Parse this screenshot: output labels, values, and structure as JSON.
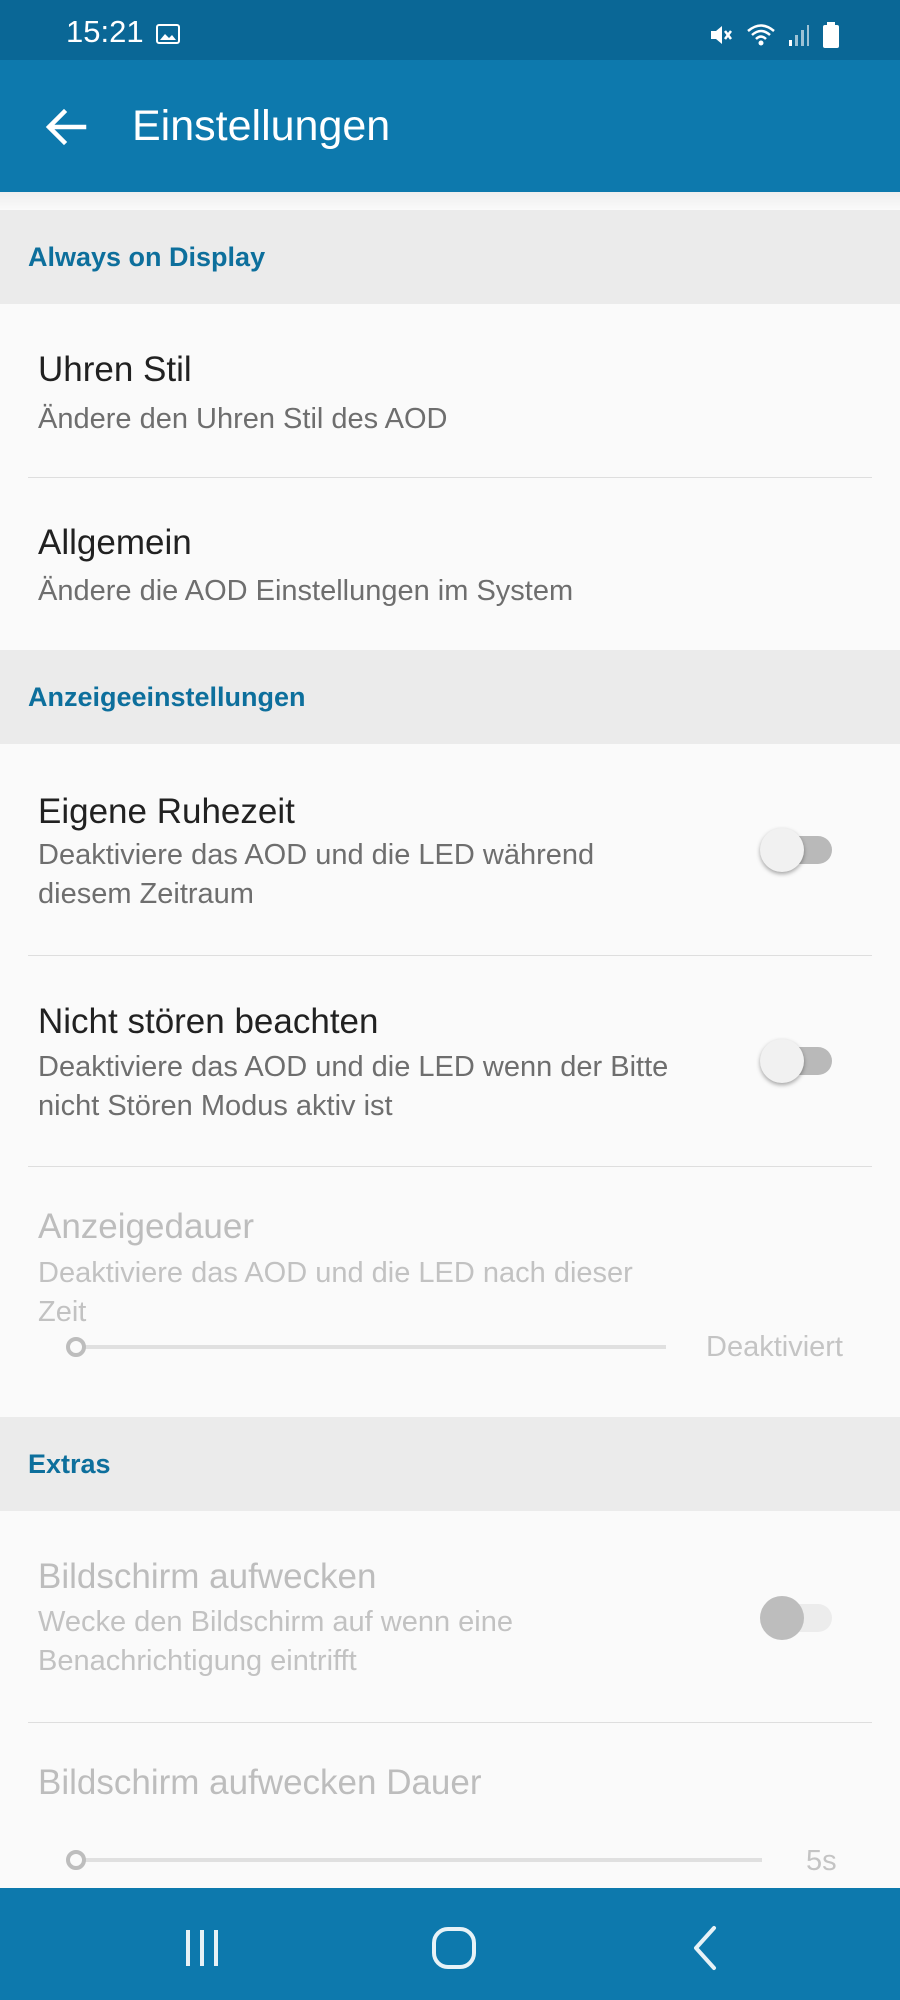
{
  "status_bar": {
    "time": "15:21",
    "icons": [
      "image-icon",
      "mute-icon",
      "wifi-icon",
      "signal-icon",
      "battery-icon"
    ]
  },
  "app_bar": {
    "title": "Einstellungen",
    "back_icon": "arrow-back-icon"
  },
  "sections": {
    "aod": "Always on Display",
    "display": "Anzeigeeinstellungen",
    "extras": "Extras"
  },
  "items": {
    "clock_style": {
      "title": "Uhren Stil",
      "subtitle": "Ändere den Uhren Stil des AOD"
    },
    "general": {
      "title": "Allgemein",
      "subtitle": "Ändere die AOD Einstellungen im System"
    },
    "quiet_time": {
      "title": "Eigene Ruhezeit",
      "subtitle": "Deaktiviere das AOD und die LED während diesem Zeitraum",
      "enabled": false
    },
    "dnd": {
      "title": "Nicht stören beachten",
      "subtitle": "Deaktiviere das AOD und die LED wenn der Bitte nicht Stören Modus aktiv ist",
      "enabled": false
    },
    "display_duration": {
      "title": "Anzeigedauer",
      "subtitle": "Deaktiviere das AOD und die LED nach dieser Zeit",
      "value_label": "Deaktiviert",
      "slider_fraction": 0.0
    },
    "wake_screen": {
      "title": "Bildschirm aufwecken",
      "subtitle": "Wecke den Bildschirm auf wenn eine Benachrichtigung eintrifft",
      "enabled": false
    },
    "wake_duration": {
      "title": "Bildschirm aufwecken Dauer",
      "value_label": "5s",
      "slider_fraction": 0.0
    }
  },
  "nav_bar": {
    "buttons": [
      "recent-apps-icon",
      "home-icon",
      "back-icon"
    ]
  },
  "colors": {
    "primary": "#0d79ad",
    "primary_dark": "#0a6796",
    "section_text": "#0d6f9c"
  }
}
